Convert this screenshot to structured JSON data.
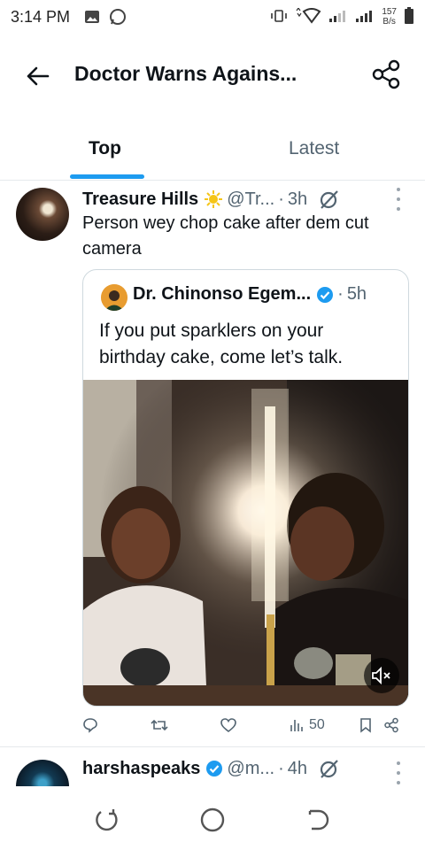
{
  "status_bar": {
    "time": "3:14 PM",
    "speed_value": "157",
    "speed_unit": "B/s",
    "icons": [
      "gallery-icon",
      "whatsapp-icon",
      "vibrate-icon",
      "data-arrows-icon",
      "wifi-icon",
      "signal-icon",
      "signal-icon",
      "battery-icon"
    ]
  },
  "header": {
    "title": "Doctor Warns Agains...",
    "back_icon": "arrow-left-icon",
    "share_icon": "share-icon"
  },
  "tabs": [
    {
      "label": "Top",
      "active": true
    },
    {
      "label": "Latest",
      "active": false
    }
  ],
  "tweet": {
    "name": "Treasure Hills",
    "name_emoji": "sun-emoji",
    "handle": "@Tr...",
    "separator": "·",
    "time": "3h",
    "text": "Person wey chop cake after dem cut camera",
    "quote": {
      "name": "Dr. Chinonso Egem...",
      "verified": true,
      "separator": "·",
      "time": "5h",
      "text": "If you put sparklers on your birthday cake, come let’s talk."
    },
    "actions": {
      "reply_count": "",
      "retweet_count": "",
      "like_count": "",
      "views_count": "50"
    }
  },
  "tweet2": {
    "name": "harshaspeaks",
    "verified": true,
    "handle": "@m...",
    "separator": "·",
    "time": "4h"
  },
  "colors": {
    "accent": "#1d9bf0",
    "text_primary": "#0f1419",
    "text_secondary": "#536471",
    "border": "#cfd9de"
  }
}
